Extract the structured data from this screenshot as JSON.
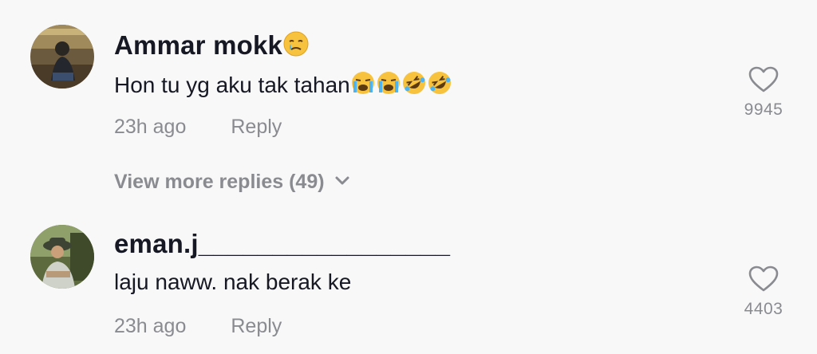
{
  "comments": [
    {
      "username": "Ammar mokk",
      "username_emoji": "crying-face",
      "text": "Hon tu yg aku tak tahan",
      "text_emojis": [
        "loudly-crying-face",
        "loudly-crying-face",
        "rolling-on-floor-laughing",
        "rolling-on-floor-laughing"
      ],
      "time": "23h ago",
      "reply_label": "Reply",
      "likes": "9945"
    },
    {
      "username": "eman.j_________________",
      "text": "laju naww. nak berak ke",
      "time": "23h ago",
      "reply_label": "Reply",
      "likes": "4403"
    }
  ],
  "view_more": {
    "label": "View more replies (49)"
  },
  "colors": {
    "text": "#161823",
    "muted": "#8a8b91",
    "background": "#f8f8f8"
  },
  "icons": {
    "like": "heart-outline-icon",
    "expand": "chevron-down-icon"
  }
}
